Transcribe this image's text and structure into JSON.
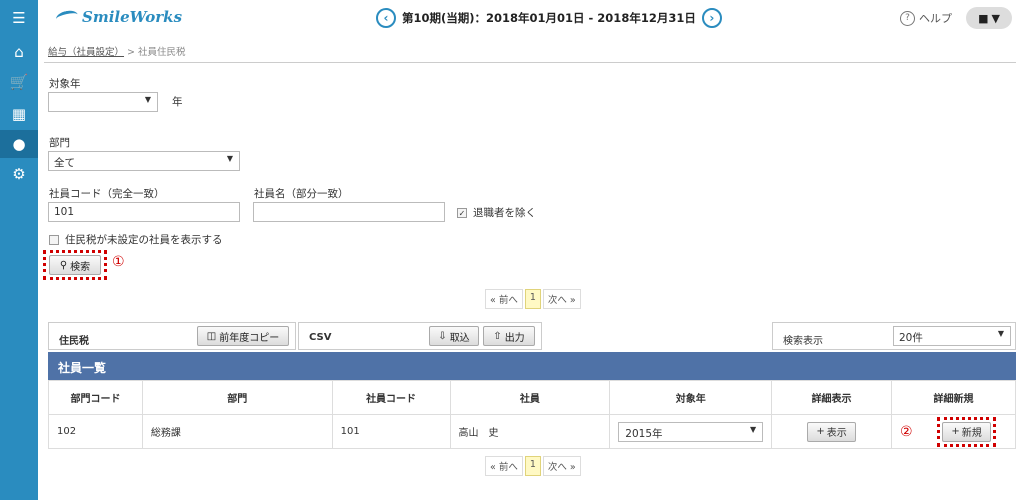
{
  "header": {
    "logo": "SmileWorks",
    "period": "第10期(当期)：2018年01月01日 - 2018年12月31日",
    "help": "ヘルプ"
  },
  "breadcrumb": {
    "parent": "給与（社員設定）",
    "sep": ">",
    "current": "社員住民税"
  },
  "form": {
    "year_label": "対象年",
    "year_value": "",
    "year_suffix": "年",
    "dept_label": "部門",
    "dept_value": "全て",
    "code_label": "社員コード（完全一致）",
    "code_value": "101",
    "name_label": "社員名（部分一致）",
    "name_value": "",
    "exclude_retired_label": "退職者を除く",
    "exclude_retired_checked": true,
    "show_unset_label": "住民税が未設定の社員を表示する",
    "show_unset_checked": false,
    "search_button": "検索",
    "mark1": "①"
  },
  "pager": {
    "prev": "« 前へ",
    "page": "1",
    "next": "次へ »"
  },
  "panels": {
    "resident_tax": "住民税",
    "copy_prev_year": "前年度コピー",
    "csv": "CSV",
    "import": "取込",
    "export": "出力",
    "display_count_label": "検索表示",
    "display_count_value": "20件"
  },
  "list": {
    "title": "社員一覧",
    "columns": [
      "部門コード",
      "部門",
      "社員コード",
      "社員",
      "対象年",
      "詳細表示",
      "詳細新規"
    ],
    "rows": [
      {
        "dept_code": "102",
        "dept": "総務課",
        "emp_code": "101",
        "emp": "高山　史",
        "year": "2015年",
        "view": "表示",
        "new": "新規"
      }
    ],
    "mark2": "②"
  }
}
